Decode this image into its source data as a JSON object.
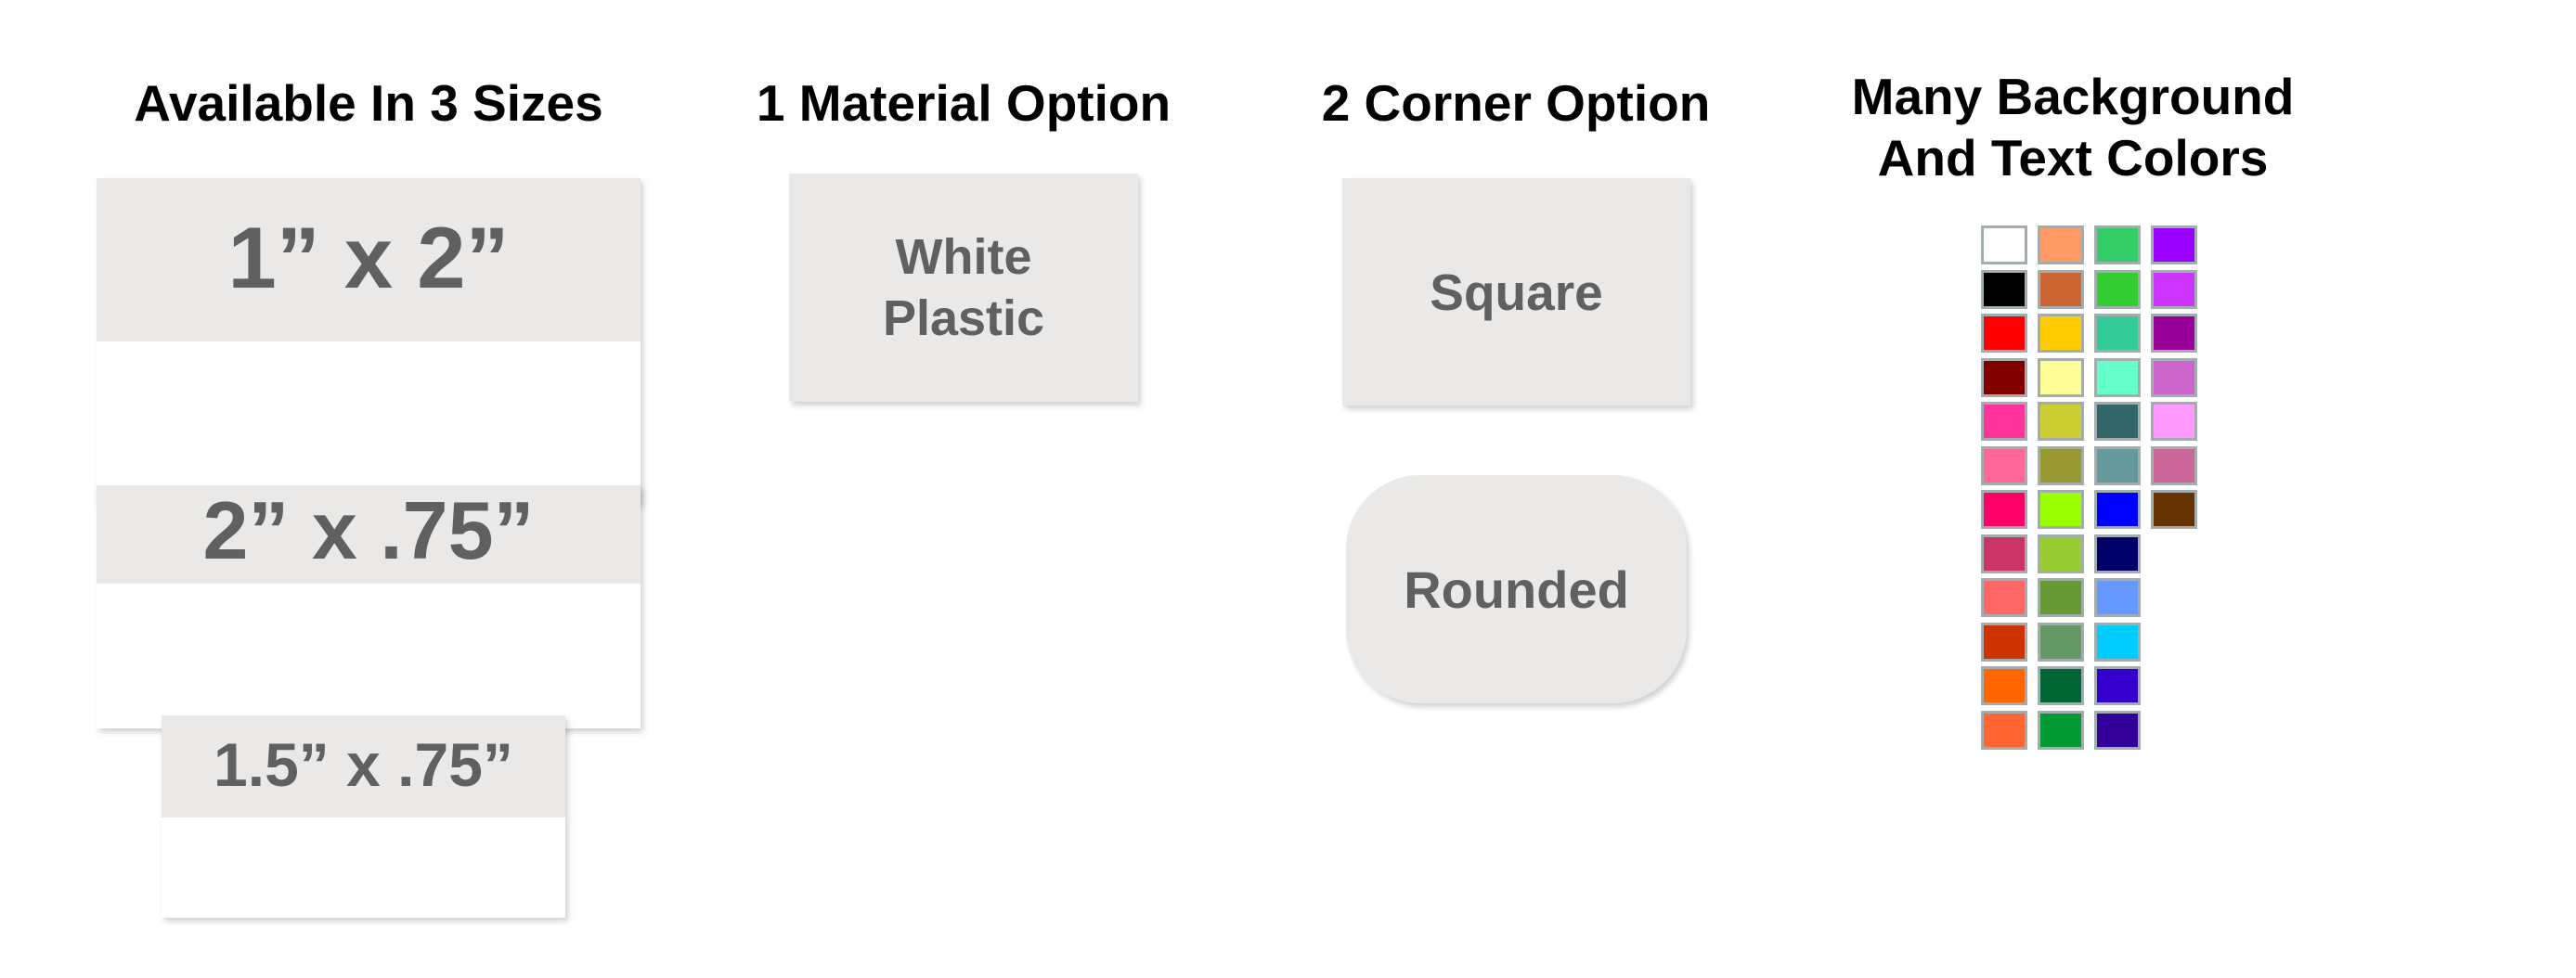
{
  "sections": {
    "sizes": {
      "heading": "Available In 3 Sizes",
      "items": [
        {
          "label": "1” x 2”"
        },
        {
          "label": "2” x .75”"
        },
        {
          "label": "1.5” x .75”"
        }
      ]
    },
    "material": {
      "heading": "1 Material Option",
      "items": [
        {
          "line1": "White",
          "line2": "Plastic"
        }
      ]
    },
    "corners": {
      "heading": "2 Corner Option",
      "items": [
        {
          "label": "Square"
        },
        {
          "label": "Rounded"
        }
      ]
    },
    "colors": {
      "heading_line1": "Many Background",
      "heading_line2": "And Text Colors",
      "columns": [
        [
          "#ffffff",
          "#000000",
          "#ff0000",
          "#800000",
          "#ff3399",
          "#ff6699",
          "#ff0066",
          "#cc3366",
          "#ff6666",
          "#cc3300",
          "#ff6600",
          "#ff6633"
        ],
        [
          "#ff9966",
          "#cc6633",
          "#ffcc00",
          "#ffff99",
          "#cccc33",
          "#999933",
          "#99ff00",
          "#99cc33",
          "#669933",
          "#669966",
          "#006633",
          "#009933"
        ],
        [
          "#33cc66",
          "#33cc33",
          "#33cc99",
          "#66ffcc",
          "#336666",
          "#669999",
          "#0000ff",
          "#000066",
          "#6699ff",
          "#00ccff",
          "#3300cc",
          "#330099"
        ],
        [
          "#9900ff",
          "#cc33ff",
          "#990099",
          "#cc66cc",
          "#ff99ff",
          "#cc6699",
          "#663300"
        ]
      ]
    }
  },
  "theme": {
    "card_bg": "#eae9e7",
    "label_color": "#606060",
    "swatch_border": "#a3adb0"
  }
}
